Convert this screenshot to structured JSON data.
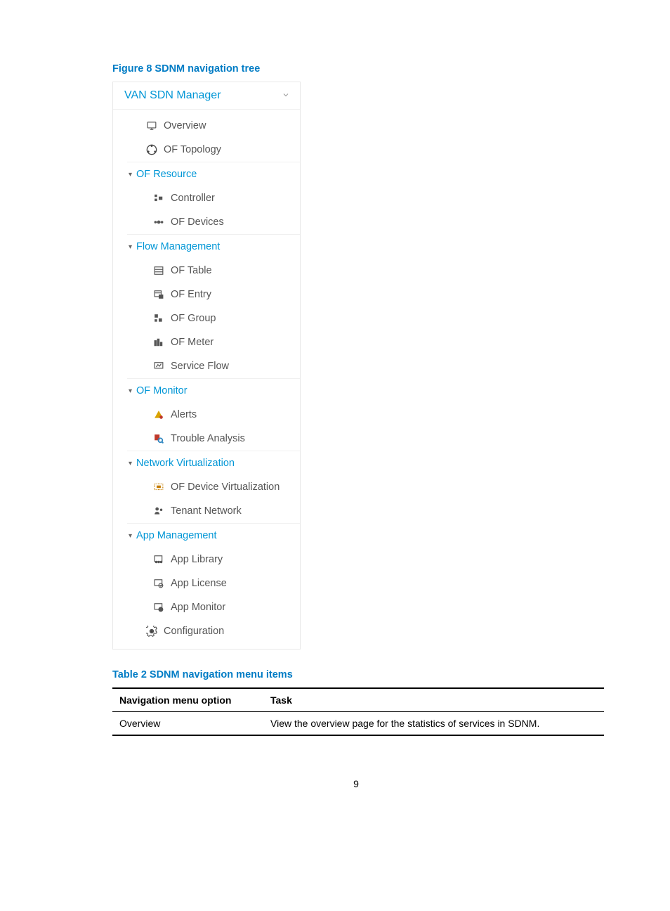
{
  "figure": {
    "caption": "Figure 8 SDNM navigation tree"
  },
  "nav": {
    "title": "VAN SDN Manager",
    "top_items": [
      {
        "label": "Overview",
        "icon": "monitor-icon"
      },
      {
        "label": "OF Topology",
        "icon": "topology-icon"
      }
    ],
    "sections": [
      {
        "label": "OF Resource",
        "items": [
          {
            "label": "Controller",
            "icon": "controller-icon"
          },
          {
            "label": "OF Devices",
            "icon": "devices-icon"
          }
        ]
      },
      {
        "label": "Flow Management",
        "items": [
          {
            "label": "OF Table",
            "icon": "table-icon"
          },
          {
            "label": "OF Entry",
            "icon": "entry-icon"
          },
          {
            "label": "OF Group",
            "icon": "group-icon"
          },
          {
            "label": "OF Meter",
            "icon": "meter-icon"
          },
          {
            "label": "Service Flow",
            "icon": "flow-icon"
          }
        ]
      },
      {
        "label": "OF Monitor",
        "items": [
          {
            "label": "Alerts",
            "icon": "alert-icon"
          },
          {
            "label": "Trouble Analysis",
            "icon": "analysis-icon"
          }
        ]
      },
      {
        "label": "Network Virtualization",
        "items": [
          {
            "label": "OF Device Virtualization",
            "icon": "virtual-icon"
          },
          {
            "label": "Tenant Network",
            "icon": "tenant-icon"
          }
        ]
      },
      {
        "label": "App Management",
        "items": [
          {
            "label": "App Library",
            "icon": "library-icon"
          },
          {
            "label": "App License",
            "icon": "license-icon"
          },
          {
            "label": "App Monitor",
            "icon": "app-monitor-icon"
          }
        ]
      }
    ],
    "footer_item": {
      "label": "Configuration",
      "icon": "gear-icon"
    }
  },
  "table": {
    "caption": "Table 2 SDNM navigation menu items",
    "headers": {
      "col1": "Navigation menu option",
      "col2": "Task"
    },
    "rows": [
      {
        "option": "Overview",
        "task": "View the overview page for the statistics of services in SDNM."
      }
    ]
  },
  "page_number": "9"
}
